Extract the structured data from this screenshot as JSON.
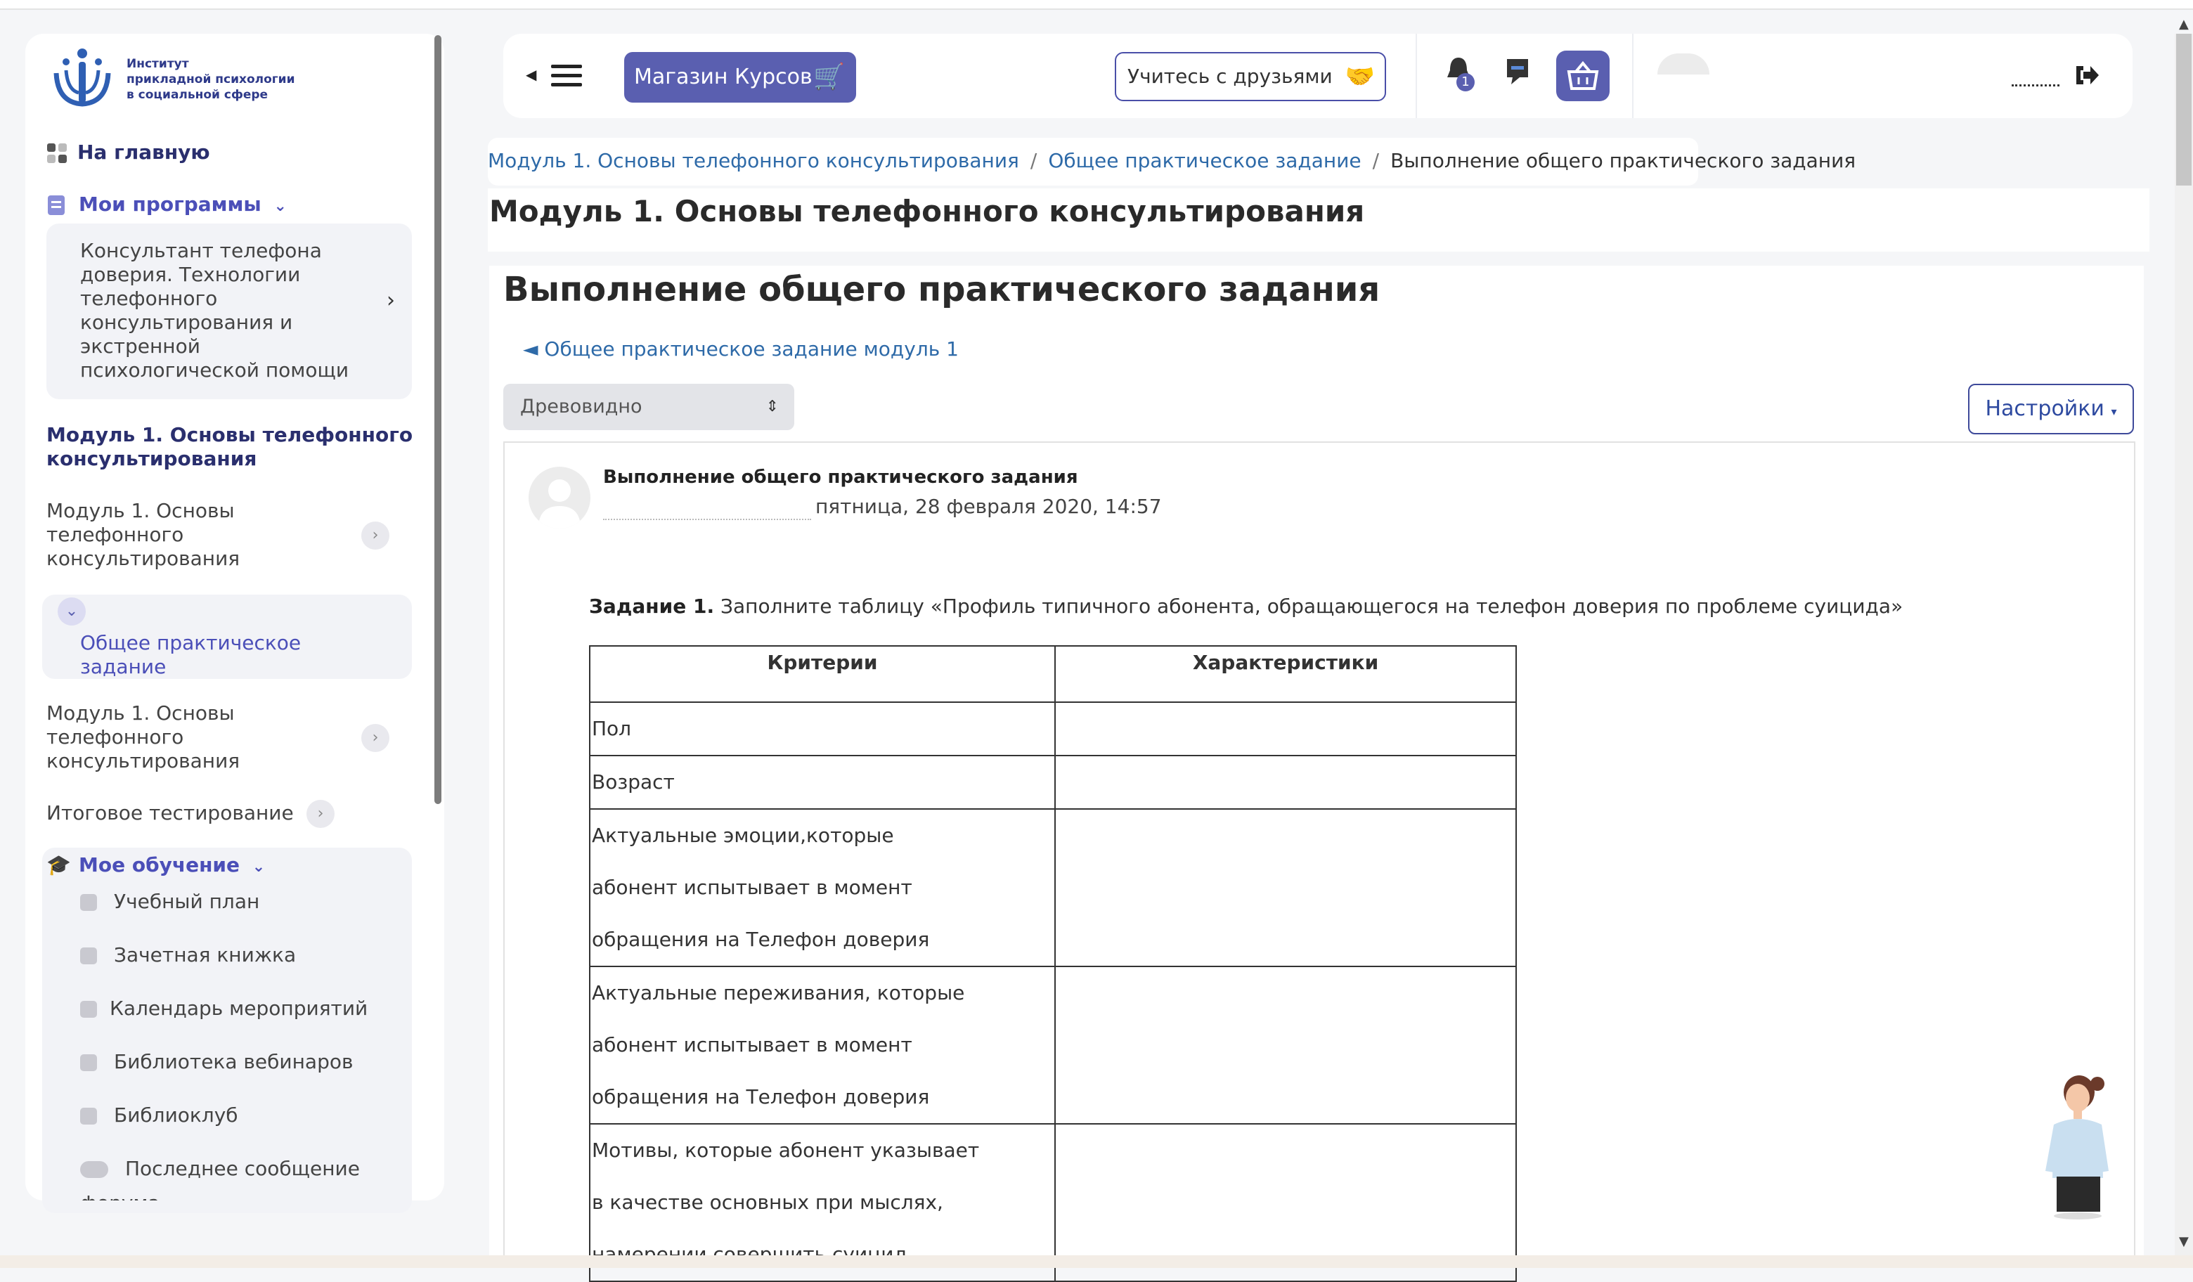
{
  "sidebar": {
    "logo_text": [
      "Институт",
      "прикладной психологии",
      "в социальной сфере"
    ],
    "home": "На главную",
    "my_programs": "Мои программы",
    "program_lines": [
      "Консультант телефона",
      "доверия. Технологии",
      "телефонного",
      "консультирования и",
      "экстренной",
      "психологической помощи"
    ],
    "module_header": [
      "Модуль 1. Основы телефонного",
      "консультирования"
    ],
    "module_item1": [
      "Модуль 1. Основы",
      "телефонного",
      "консультирования"
    ],
    "active_item": [
      "Общее практическое",
      "задание"
    ],
    "module_item2": [
      "Модуль 1. Основы",
      "телефонного",
      "консультирования"
    ],
    "final_test": "Итоговое тестирование",
    "my_learning": "Мое обучение",
    "learning_items": [
      "Учебный план",
      "Зачетная книжка",
      "Календарь мероприятий",
      "Библиотека вебинаров",
      "Библиоклуб",
      "Последнее сообщение"
    ],
    "cut_text": "форума"
  },
  "header": {
    "shop": "Магазин Курсов",
    "friends": "Учитесь с друзьями",
    "notif_count": "1"
  },
  "breadcrumb": {
    "item1": "Модуль 1. Основы телефонного консультирования",
    "item2": "Общее практическое задание",
    "current": "Выполнение общего практического задания",
    "separator": "/"
  },
  "course_title": "Модуль 1. Основы телефонного консультирования",
  "page_title": "Выполнение общего практического задания",
  "back_link": "◄ Общее практическое задание модуль 1",
  "display_mode": "Древовидно",
  "settings": "Настройки",
  "post": {
    "subject": "Выполнение общего практического задания",
    "date": "пятница, 28 февраля 2020, 14:57",
    "task_label": "Задание 1.",
    "task_text": " Заполните таблицу «Профиль типичного абонента, обращающегося на телефон доверия по проблеме суицида»"
  },
  "table": {
    "headers": [
      "Критерии",
      "Характеристики"
    ],
    "rows": [
      [
        "Пол"
      ],
      [
        "Возраст"
      ],
      [
        "Актуальные эмоции,которые",
        "абонент испытывает в момент",
        "обращения на Телефон доверия"
      ],
      [
        "Актуальные переживания, которые",
        "абонент испытывает в момент",
        "обращения на Телефон доверия"
      ],
      [
        "Мотивы, которые абонент указывает",
        "в качестве основных при мыслях,",
        "намерении совершить суицид"
      ]
    ]
  },
  "colors": {
    "accent": "#5a5fb0",
    "link": "#2e6aa8",
    "title": "#2a2f6e"
  }
}
